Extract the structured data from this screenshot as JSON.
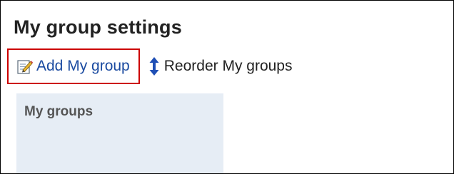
{
  "page": {
    "title": "My group settings"
  },
  "toolbar": {
    "add_label": "Add My group",
    "add_icon": "edit-note-icon",
    "reorder_label": "Reorder My groups",
    "reorder_icon": "vertical-arrows-icon",
    "highlight_color": "#cc0000",
    "link_color": "#1a4aa0"
  },
  "groups_panel": {
    "title": "My groups",
    "background": "#e6edf5"
  }
}
